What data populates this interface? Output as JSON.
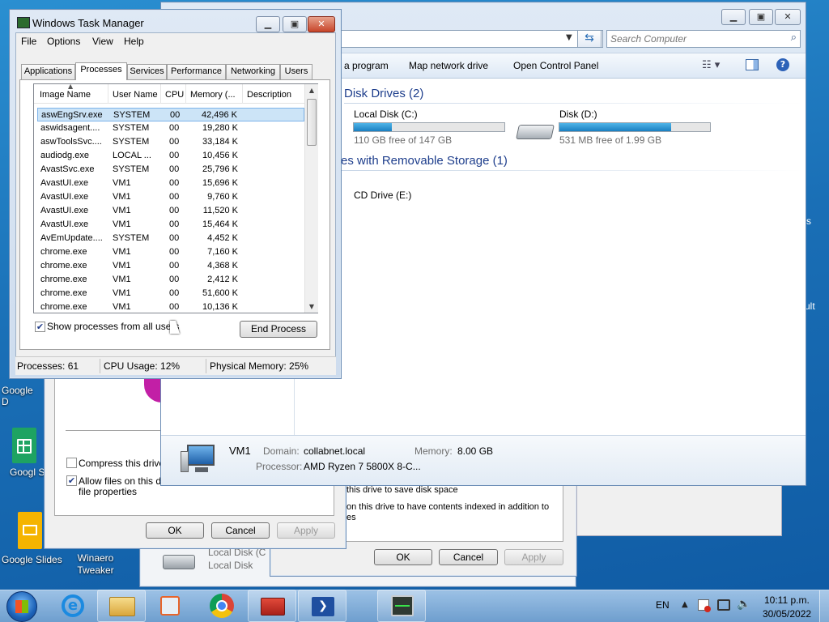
{
  "desktop": {
    "icons": [
      {
        "label": "Google D",
        "name": "google-docs-icon"
      },
      {
        "label": "Googl Sheet",
        "name": "google-sheets-icon"
      },
      {
        "label": "Google Slides",
        "name": "google-slides-icon"
      },
      {
        "label": "Winaero Tweaker",
        "name": "winaero-tweaker-icon"
      }
    ]
  },
  "task_manager": {
    "title": "Windows Task Manager",
    "menu": [
      "File",
      "Options",
      "View",
      "Help"
    ],
    "tabs": [
      "Applications",
      "Processes",
      "Services",
      "Performance",
      "Networking",
      "Users"
    ],
    "columns": [
      "Image Name",
      "User Name",
      "CPU",
      "Memory (...",
      "Description"
    ],
    "rows": [
      [
        "aswEngSrv.exe",
        "SYSTEM",
        "00",
        "42,496 K"
      ],
      [
        "aswidsagent....",
        "SYSTEM",
        "00",
        "19,280 K"
      ],
      [
        "aswToolsSvc....",
        "SYSTEM",
        "00",
        "33,184 K"
      ],
      [
        "audiodg.exe",
        "LOCAL ...",
        "00",
        "10,456 K"
      ],
      [
        "AvastSvc.exe",
        "SYSTEM",
        "00",
        "25,796 K"
      ],
      [
        "AvastUI.exe",
        "VM1",
        "00",
        "15,696 K"
      ],
      [
        "AvastUI.exe",
        "VM1",
        "00",
        "9,760 K"
      ],
      [
        "AvastUI.exe",
        "VM1",
        "00",
        "11,520 K"
      ],
      [
        "AvastUI.exe",
        "VM1",
        "00",
        "15,464 K"
      ],
      [
        "AvEmUpdate....",
        "SYSTEM",
        "00",
        "4,452 K"
      ],
      [
        "chrome.exe",
        "VM1",
        "00",
        "7,160 K"
      ],
      [
        "chrome.exe",
        "VM1",
        "00",
        "4,368 K"
      ],
      [
        "chrome.exe",
        "VM1",
        "00",
        "2,412 K"
      ],
      [
        "chrome.exe",
        "VM1",
        "00",
        "51,600 K"
      ],
      [
        "chrome.exe",
        "VM1",
        "00",
        "10,136 K"
      ]
    ],
    "show_all_label": "Show processes from all users",
    "end_process": "End Process",
    "status": {
      "processes": "Processes: 61",
      "cpu": "CPU Usage: 12%",
      "memory": "Physical Memory: 25%"
    }
  },
  "explorer": {
    "search_placeholder": "Search Computer",
    "toolbar": [
      "a program",
      "Map network drive",
      "Open Control Panel"
    ],
    "hdd_header": "Disk Drives (2)",
    "removable_header": "es with Removable Storage (1)",
    "drives": [
      {
        "name": "Local Disk (C:)",
        "free": "110 GB free of 147 GB",
        "used_fraction": 0.25
      },
      {
        "name": "Disk (D:)",
        "free": "531 MB free of 1.99 GB",
        "used_fraction": 0.74
      }
    ],
    "cd": "CD Drive (E:)",
    "details": {
      "pc": "VM1",
      "domain_label": "Domain:",
      "domain": "collabnet.local",
      "memory_label": "Memory:",
      "memory": "8.00 GB",
      "processor_label": "Processor:",
      "processor": "AMD Ryzen 7 5800X 8-C..."
    }
  },
  "props_left": {
    "compress": "Compress this drive to",
    "allow1": "Allow files on this driv",
    "allow2": "file properties",
    "ok": "OK",
    "cancel": "Cancel",
    "apply": "Apply"
  },
  "props_right": {
    "compress": "this drive to save disk space",
    "index1": "on this drive to have contents indexed in addition to",
    "index2": "es",
    "ok": "OK",
    "cancel": "Cancel",
    "apply": "Apply"
  },
  "bottom_window": {
    "name": "Local Disk (C",
    "sub": "Local Disk"
  },
  "edge_text": {
    "a": "s",
    "b": "ult"
  },
  "taskbar": {
    "lang": "EN",
    "time": "10:11 p.m.",
    "date": "30/05/2022"
  }
}
